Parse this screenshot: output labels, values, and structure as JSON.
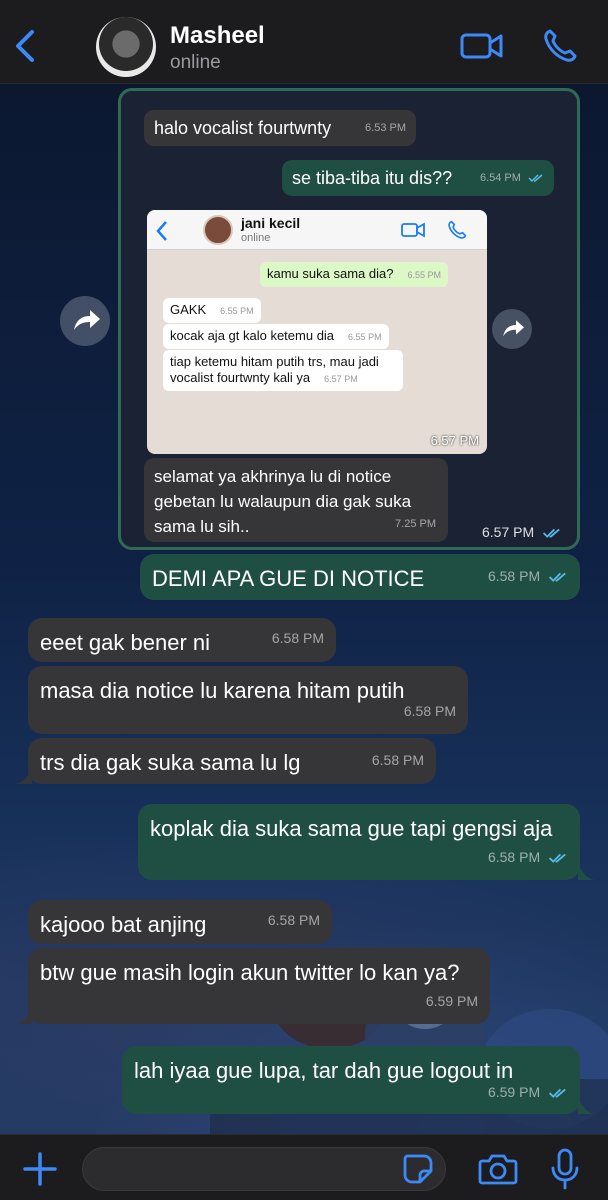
{
  "header": {
    "contact_name": "Masheel",
    "status": "online",
    "back_icon": "chevron-left-icon",
    "video_icon": "video-camera-icon",
    "phone_icon": "phone-icon"
  },
  "forwarded": {
    "top_message": {
      "text": "halo vocalist fourtwnty",
      "time": "6.53 PM"
    },
    "reply_message": {
      "text": "se tiba-tiba itu dis??",
      "time": "6.54 PM"
    },
    "screenshot": {
      "contact_name": "jani kecil",
      "status": "online",
      "messages": [
        {
          "text": "kamu suka sama dia?",
          "time": "6.55 PM",
          "mine": true
        },
        {
          "text": "GAKK",
          "time": "6.55 PM",
          "mine": false
        },
        {
          "text": "kocak aja gt kalo ketemu dia",
          "time": "6.55 PM",
          "mine": false
        },
        {
          "text": "tiap ketemu hitam putih trs, mau jadi vocalist fourtwnty kali ya",
          "time": "6.57 PM",
          "mine": false
        }
      ],
      "stamp": "6.57 PM"
    },
    "caption": {
      "text": "selamat ya akhrinya lu di notice gebetan lu walaupun dia gak suka sama lu sih..",
      "time": "7.25 PM"
    },
    "card_time": "6.57 PM"
  },
  "messages": [
    {
      "text": "DEMI APA GUE DI NOTICE",
      "time": "6.58 PM",
      "dir": "out"
    },
    {
      "text": "eeet gak bener ni",
      "time": "6.58 PM",
      "dir": "in"
    },
    {
      "text": "masa dia notice lu karena hitam putih",
      "time": "6.58 PM",
      "dir": "in"
    },
    {
      "text": "trs dia gak suka sama lu lg",
      "time": "6.58 PM",
      "dir": "in"
    },
    {
      "text": "koplak dia suka sama gue tapi gengsi aja",
      "time": "6.58 PM",
      "dir": "out"
    },
    {
      "text": "kajooo bat anjing",
      "time": "6.58 PM",
      "dir": "in"
    },
    {
      "text": "btw gue masih login akun twitter lo kan ya?",
      "time": "6.59 PM",
      "dir": "in"
    },
    {
      "text": "lah iyaa gue lupa, tar dah gue logout in",
      "time": "6.59 PM",
      "dir": "out"
    }
  ],
  "composer": {
    "placeholder": "",
    "plus_icon": "plus-icon",
    "sticker_icon": "sticker-icon",
    "camera_icon": "camera-icon",
    "mic_icon": "microphone-icon"
  },
  "colors": {
    "accent": "#3d8af7",
    "incoming_bubble": "#363638",
    "outgoing_bubble": "#1f4f42",
    "read_ticks": "#53bdeb"
  }
}
